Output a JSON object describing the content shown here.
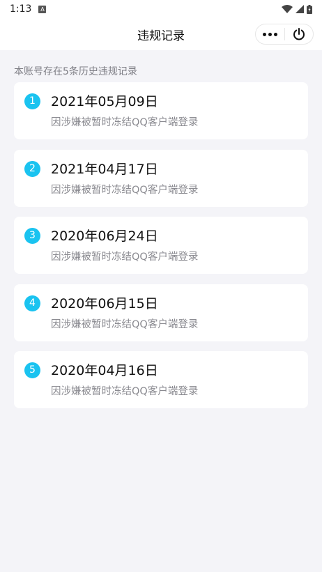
{
  "status_bar": {
    "time": "1:13",
    "notif_glyph": "A"
  },
  "header": {
    "title": "违规记录"
  },
  "summary": "本账号存在5条历史违规记录",
  "records": [
    {
      "num": "1",
      "date": "2021年05月09日",
      "reason": "因涉嫌被暂时冻结QQ客户端登录"
    },
    {
      "num": "2",
      "date": "2021年04月17日",
      "reason": "因涉嫌被暂时冻结QQ客户端登录"
    },
    {
      "num": "3",
      "date": "2020年06月24日",
      "reason": "因涉嫌被暂时冻结QQ客户端登录"
    },
    {
      "num": "4",
      "date": "2020年06月15日",
      "reason": "因涉嫌被暂时冻结QQ客户端登录"
    },
    {
      "num": "5",
      "date": "2020年04月16日",
      "reason": "因涉嫌被暂时冻结QQ客户端登录"
    }
  ],
  "icons": {
    "status": [
      "notification-icon",
      "wifi-icon",
      "signal-icon",
      "battery-icon"
    ],
    "capsule": [
      "more-icon",
      "power-icon"
    ]
  },
  "colors": {
    "accent": "#1ac3f0",
    "background": "#f4f4f8"
  }
}
